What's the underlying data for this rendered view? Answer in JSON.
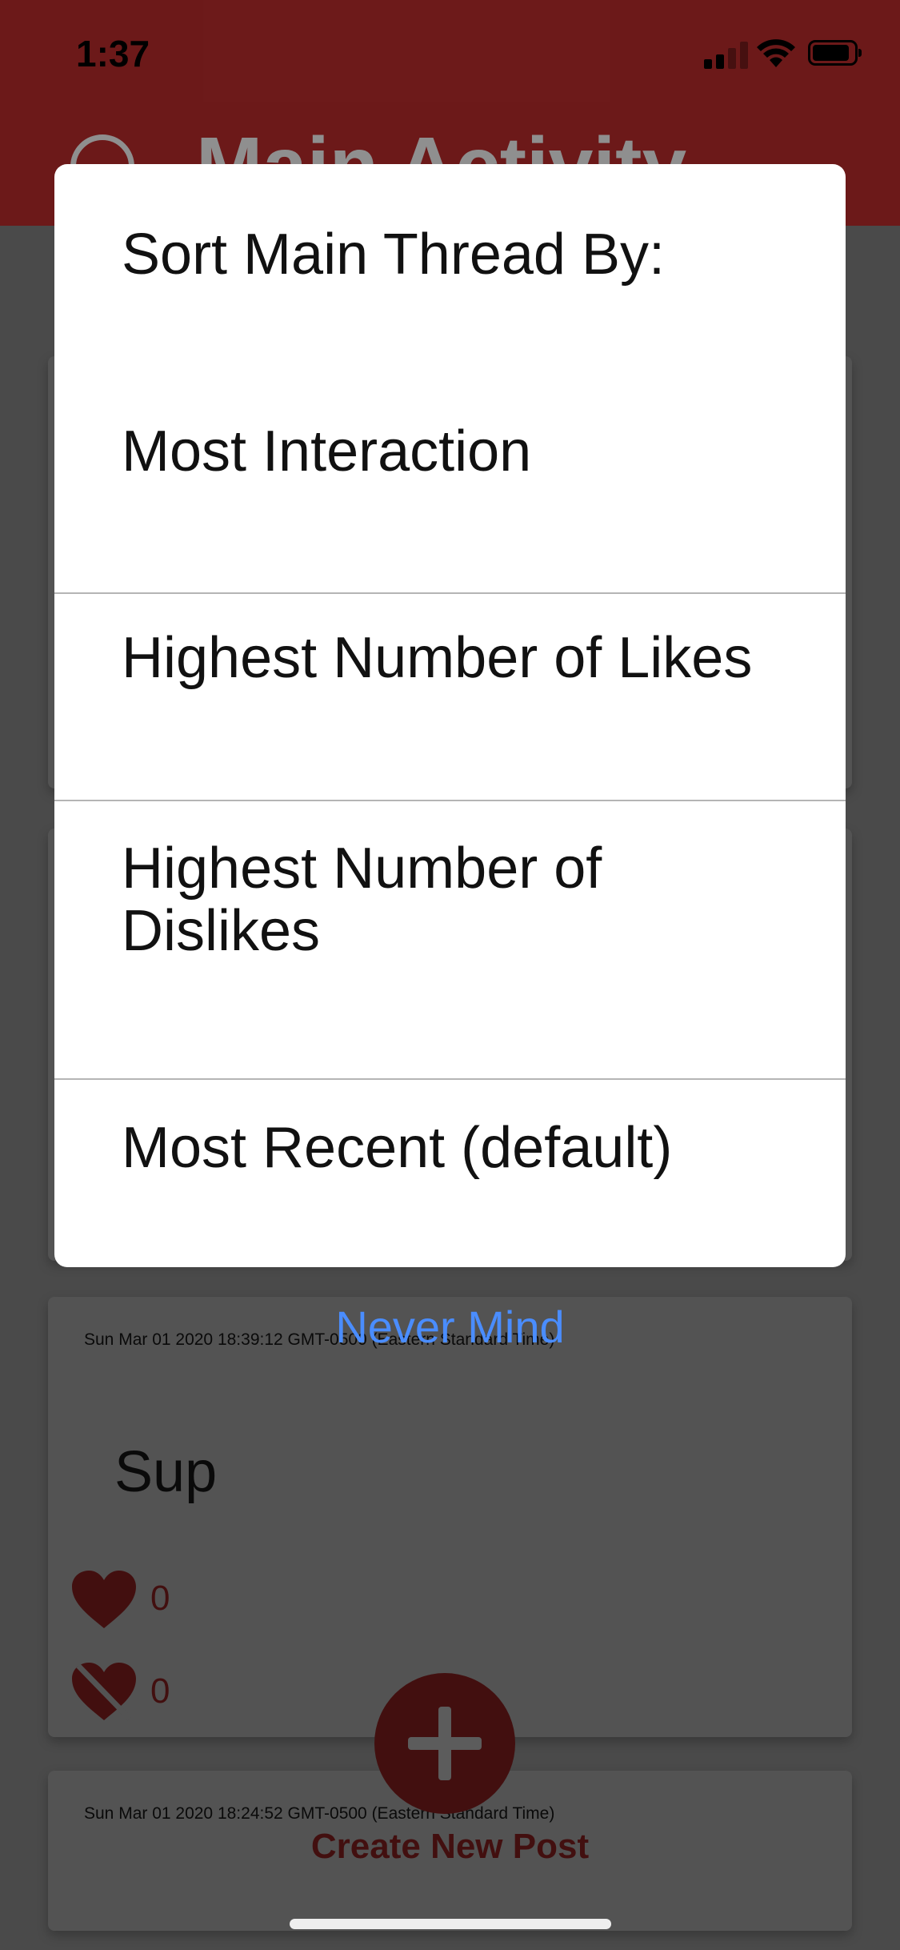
{
  "status_bar": {
    "time": "1:37"
  },
  "header": {
    "title": "Main Activity"
  },
  "posts": [
    {
      "date": "Sun Mar 01 2020 18:39:12 GMT-0500 (Eastern Standard Time)",
      "text": "Sup",
      "likes": "0",
      "dislikes": "0"
    },
    {
      "date": "Sun Mar 01 2020 18:24:52 GMT-0500 (Eastern Standard Time)"
    }
  ],
  "create_post": {
    "label": "Create New Post"
  },
  "sort_dialog": {
    "title": "Sort Main Thread By:",
    "options": [
      {
        "label": "Most Interaction"
      },
      {
        "label": "Highest Number of Likes"
      },
      {
        "label": "Highest Number of Dislikes"
      },
      {
        "label": "Most Recent (default)"
      }
    ],
    "cancel_label": "Never Mind"
  },
  "colors": {
    "accent_red": "#b52b2b",
    "link_blue": "#4a8dff"
  }
}
